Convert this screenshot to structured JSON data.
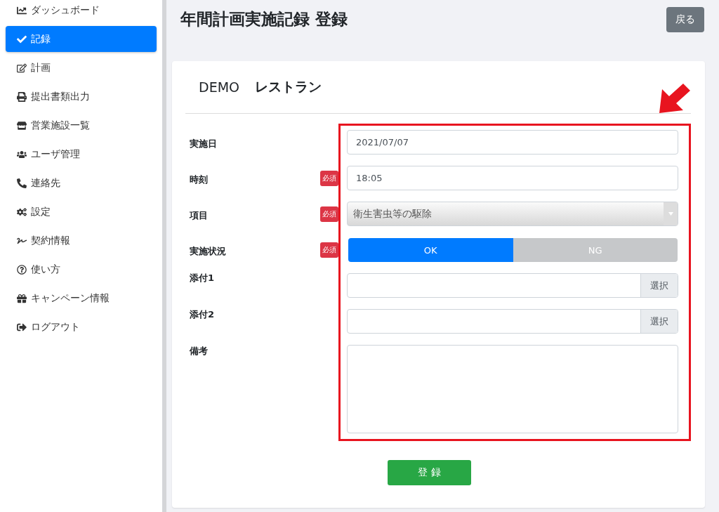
{
  "sidebar": {
    "items": [
      {
        "label": "ダッシュボード",
        "selected": false
      },
      {
        "label": "記録",
        "selected": true
      },
      {
        "label": "計画",
        "selected": false
      },
      {
        "label": "提出書類出力",
        "selected": false
      },
      {
        "label": "営業施設一覧",
        "selected": false
      },
      {
        "label": "ユーザ管理",
        "selected": false
      },
      {
        "label": "連絡先",
        "selected": false
      },
      {
        "label": "設定",
        "selected": false
      },
      {
        "label": "契約情報",
        "selected": false
      },
      {
        "label": "使い方",
        "selected": false
      },
      {
        "label": "キャンペーン情報",
        "selected": false
      },
      {
        "label": "ログアウト",
        "selected": false
      }
    ]
  },
  "page": {
    "title": "年間計画実施記録 登録",
    "back_button": "戻る"
  },
  "card": {
    "store_code": "DEMO",
    "store_name": "レストラン",
    "fields": [
      {
        "kind": "text",
        "label": "実施日",
        "value": "2021/07/07"
      },
      {
        "kind": "text",
        "label": "時刻",
        "badge": "必須",
        "value": "18:05"
      },
      {
        "kind": "select",
        "label": "項目",
        "badge": "必須",
        "value": "衛生害虫等の駆除"
      },
      {
        "kind": "toggle",
        "label": "実施状況",
        "badge": "必須",
        "options": [
          {
            "label": "OK",
            "selected": true
          },
          {
            "label": "NG",
            "selected": false
          }
        ]
      },
      {
        "kind": "file",
        "label": "添付1",
        "button": "選択"
      },
      {
        "kind": "file",
        "label": "添付2",
        "button": "選択"
      },
      {
        "kind": "textarea",
        "label": "備考"
      }
    ],
    "submit": "登 録"
  }
}
